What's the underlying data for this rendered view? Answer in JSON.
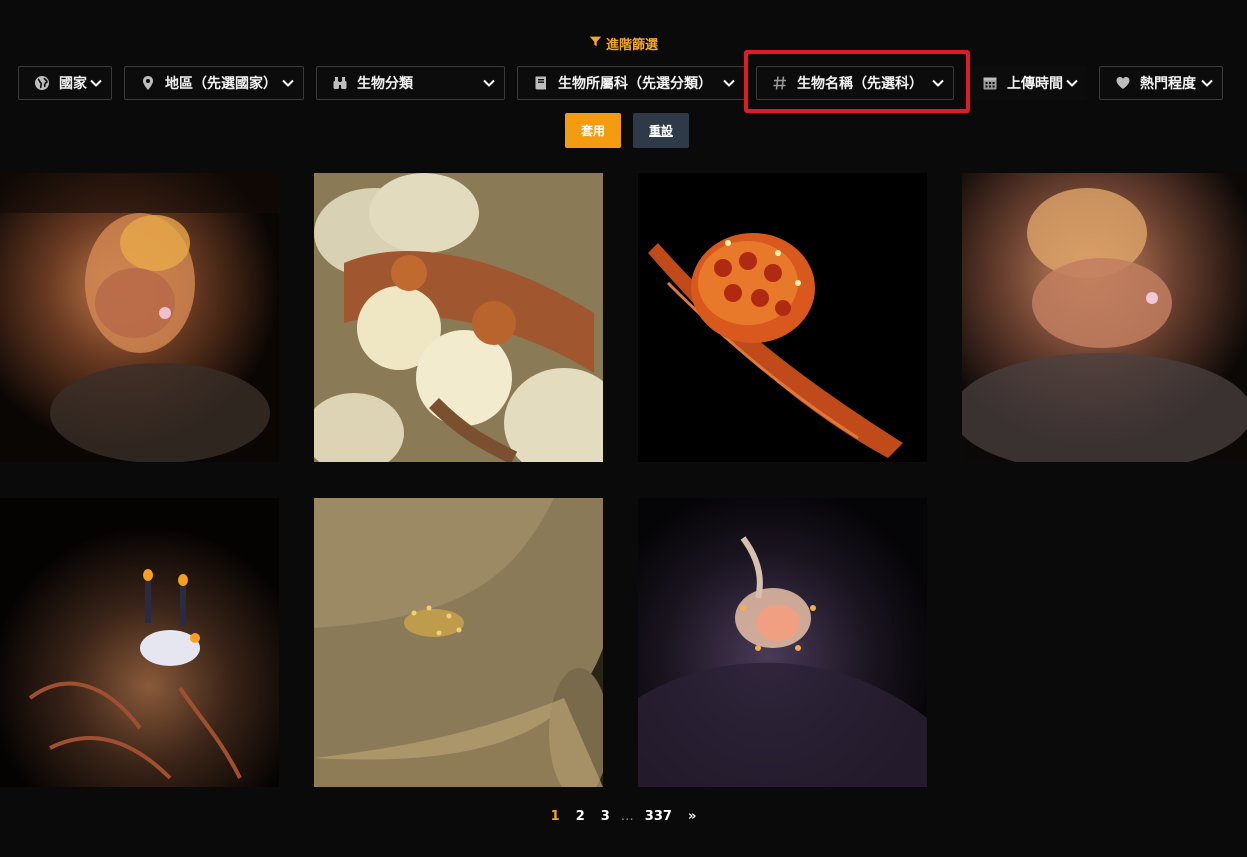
{
  "advanced_filter": {
    "label": "進階篩選",
    "icon": "filter-icon",
    "color": "#f5a623"
  },
  "filters": [
    {
      "label": "國家",
      "icon": "globe-icon"
    },
    {
      "label": "地區（先選國家）",
      "icon": "map-pin-icon"
    },
    {
      "label": "生物分類",
      "icon": "binoculars-icon"
    },
    {
      "label": "生物所屬科（先選分類）",
      "icon": "book-icon"
    },
    {
      "label": "生物名稱（先選科）",
      "icon": "hashtag-icon",
      "highlighted": true
    },
    {
      "label": "上傳時間",
      "icon": "calendar-icon"
    },
    {
      "label": "熱門程度",
      "icon": "heart-icon"
    }
  ],
  "buttons": {
    "apply": "套用",
    "reset": "重設"
  },
  "colors": {
    "accent": "#f5a623",
    "apply_bg": "#f39c12",
    "reset_bg": "#2f3a48",
    "highlight": "#e01b24",
    "background": "#0a0a0a"
  },
  "gallery": [
    {
      "subject": "anemone-shrimp-photo"
    },
    {
      "subject": "boxer-crab-photo"
    },
    {
      "subject": "flamingo-tongue-snail-photo"
    },
    {
      "subject": "anemone-shrimp-photo-2"
    },
    {
      "subject": "nudibranch-photo"
    },
    {
      "subject": "shrimp-on-coral-photo"
    },
    {
      "subject": "shrimp-in-anemone-photo"
    }
  ],
  "pagination": {
    "pages": [
      "1",
      "2",
      "3"
    ],
    "ellipsis": "…",
    "last": "337",
    "next": "»",
    "current": "1"
  }
}
